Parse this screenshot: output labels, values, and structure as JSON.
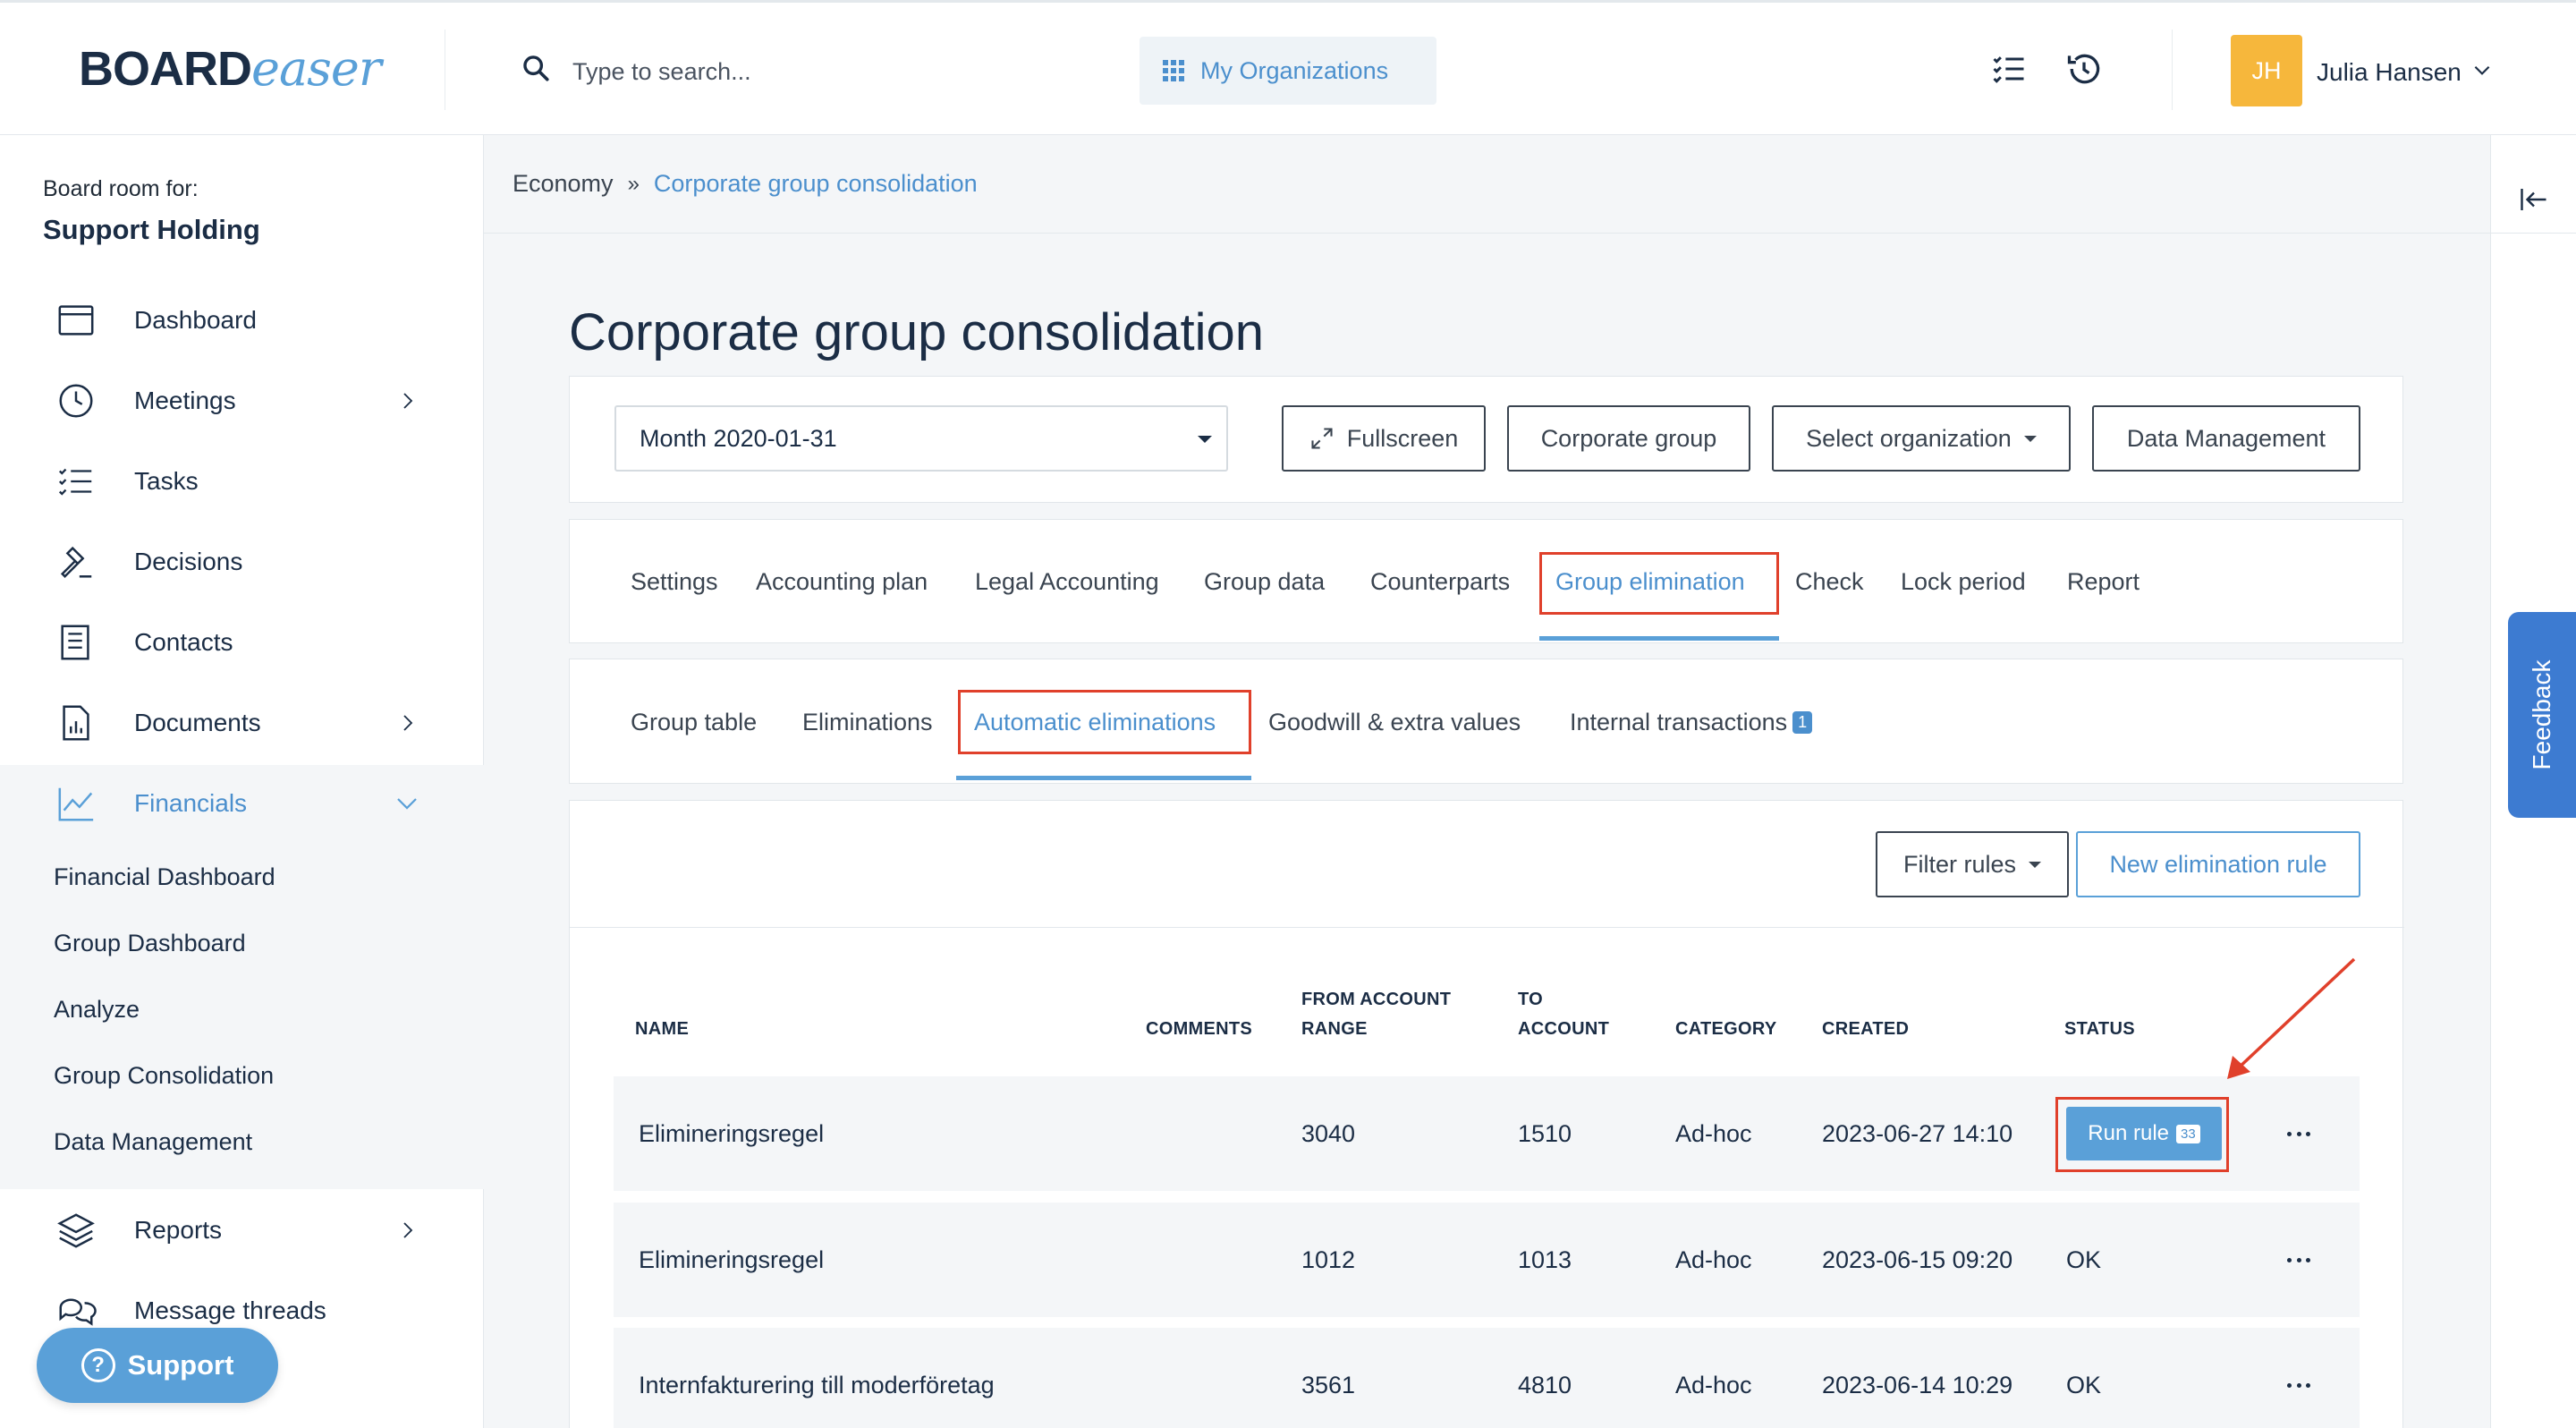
{
  "header": {
    "logo_main": "BOARD",
    "logo_accent": "easer",
    "search_placeholder": "Type to search...",
    "my_orgs_label": "My Organizations",
    "user_initials": "JH",
    "user_name": "Julia Hansen",
    "icons": [
      "search-icon",
      "grid-icon",
      "task-list-icon",
      "history-icon",
      "chevron-down-icon"
    ]
  },
  "sidebar": {
    "board_for_label": "Board room for:",
    "board_name": "Support Holding",
    "items": [
      {
        "label": "Dashboard",
        "icon": "calendar-icon"
      },
      {
        "label": "Meetings",
        "icon": "clock-icon"
      },
      {
        "label": "Tasks",
        "icon": "task-list-icon"
      },
      {
        "label": "Decisions",
        "icon": "gavel-icon"
      },
      {
        "label": "Contacts",
        "icon": "address-book-icon"
      },
      {
        "label": "Documents",
        "icon": "document-chart-icon"
      },
      {
        "label": "Financials",
        "icon": "line-chart-icon"
      },
      {
        "label": "Reports",
        "icon": "layers-icon"
      },
      {
        "label": "Message threads",
        "icon": "chat-bubbles-icon"
      }
    ],
    "financials_sub": [
      "Financial Dashboard",
      "Group Dashboard",
      "Analyze",
      "Group Consolidation",
      "Data Management"
    ],
    "support_label": "Support"
  },
  "feedback_label": "Feedback",
  "breadcrumb": {
    "root": "Economy",
    "separator": "»",
    "current": "Corporate group consolidation"
  },
  "page_title": "Corporate group consolidation",
  "toolbar": {
    "period": "Month 2020-01-31",
    "fullscreen": "Fullscreen",
    "corporate_group": "Corporate group",
    "select_org": "Select organization",
    "data_management": "Data Management"
  },
  "main_tabs": [
    "Settings",
    "Accounting plan",
    "Legal Accounting",
    "Group data",
    "Counterparts",
    "Group elimination",
    "Check",
    "Lock period",
    "Report"
  ],
  "sub_tabs": {
    "group_table": "Group table",
    "eliminations": "Eliminations",
    "automatic": "Automatic eliminations",
    "goodwill": "Goodwill & extra values",
    "internal": "Internal transactions",
    "internal_badge": "1"
  },
  "actions": {
    "filter_rules": "Filter rules",
    "new_rule": "New elimination rule"
  },
  "table": {
    "headers": {
      "name": "NAME",
      "comments": "COMMENTS",
      "from_1": "FROM ACCOUNT",
      "from_2": "RANGE",
      "to_1": "TO",
      "to_2": "ACCOUNT",
      "category": "CATEGORY",
      "created": "CREATED",
      "status": "STATUS"
    },
    "rows": [
      {
        "name": "Elimineringsregel",
        "comments": "",
        "from": "3040",
        "to": "1510",
        "category": "Ad-hoc",
        "created": "2023-06-27 14:10",
        "status": "Run rule",
        "status_count": "33"
      },
      {
        "name": "Elimineringsregel",
        "comments": "",
        "from": "1012",
        "to": "1013",
        "category": "Ad-hoc",
        "created": "2023-06-15 09:20",
        "status": "OK"
      },
      {
        "name": "Internfakturering till moderföretag",
        "comments": "",
        "from": "3561",
        "to": "4810",
        "category": "Ad-hoc",
        "created": "2023-06-14 10:29",
        "status": "OK"
      }
    ]
  },
  "colors": {
    "accent": "#5aa0d8",
    "link": "#4b8fcd",
    "highlight": "#e0402b",
    "avatar": "#f6b73c",
    "feedback": "#3d7bd1"
  }
}
